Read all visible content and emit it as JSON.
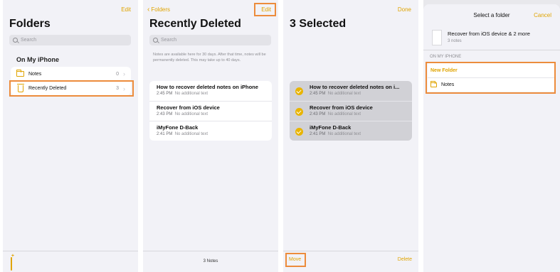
{
  "colors": {
    "accent": "#e0a400",
    "highlight": "#ec8c3c"
  },
  "screen1": {
    "edit": "Edit",
    "title": "Folders",
    "search_placeholder": "Search",
    "section": "On My iPhone",
    "folders": [
      {
        "label": "Notes",
        "count": "0",
        "icon": "folder-icon"
      },
      {
        "label": "Recently Deleted",
        "count": "3",
        "icon": "trash-icon"
      }
    ]
  },
  "screen2": {
    "back": "Folders",
    "edit": "Edit",
    "title": "Recently Deleted",
    "search_placeholder": "Search",
    "info": "Notes are available here for 30 days. After that time, notes will be permanently deleted. This may take up to 40 days.",
    "notes": [
      {
        "title": "How to recover deleted notes on iPhone",
        "time": "2:45 PM",
        "detail": "No additional text"
      },
      {
        "title": "Recover from iOS device",
        "time": "2:43 PM",
        "detail": "No additional text"
      },
      {
        "title": "iMyFone D-Back",
        "time": "2:41 PM",
        "detail": "No additional text"
      }
    ],
    "footer": "3 Notes"
  },
  "screen3": {
    "done": "Done",
    "title": "3 Selected",
    "notes": [
      {
        "title": "How to recover deleted notes on i...",
        "time": "2:45 PM",
        "detail": "No additional text"
      },
      {
        "title": "Recover from iOS device",
        "time": "2:43 PM",
        "detail": "No additional text"
      },
      {
        "title": "iMyFone D-Back",
        "time": "2:41 PM",
        "detail": "No additional text"
      }
    ],
    "move": "Move",
    "delete": "Delete"
  },
  "screen4": {
    "title": "Select a folder",
    "cancel": "Cancel",
    "items": "Recover from iOS device & 2 more",
    "count": "3 notes",
    "section": "ON MY IPHONE",
    "new_folder": "New Folder",
    "folders": [
      {
        "label": "Notes"
      }
    ]
  }
}
